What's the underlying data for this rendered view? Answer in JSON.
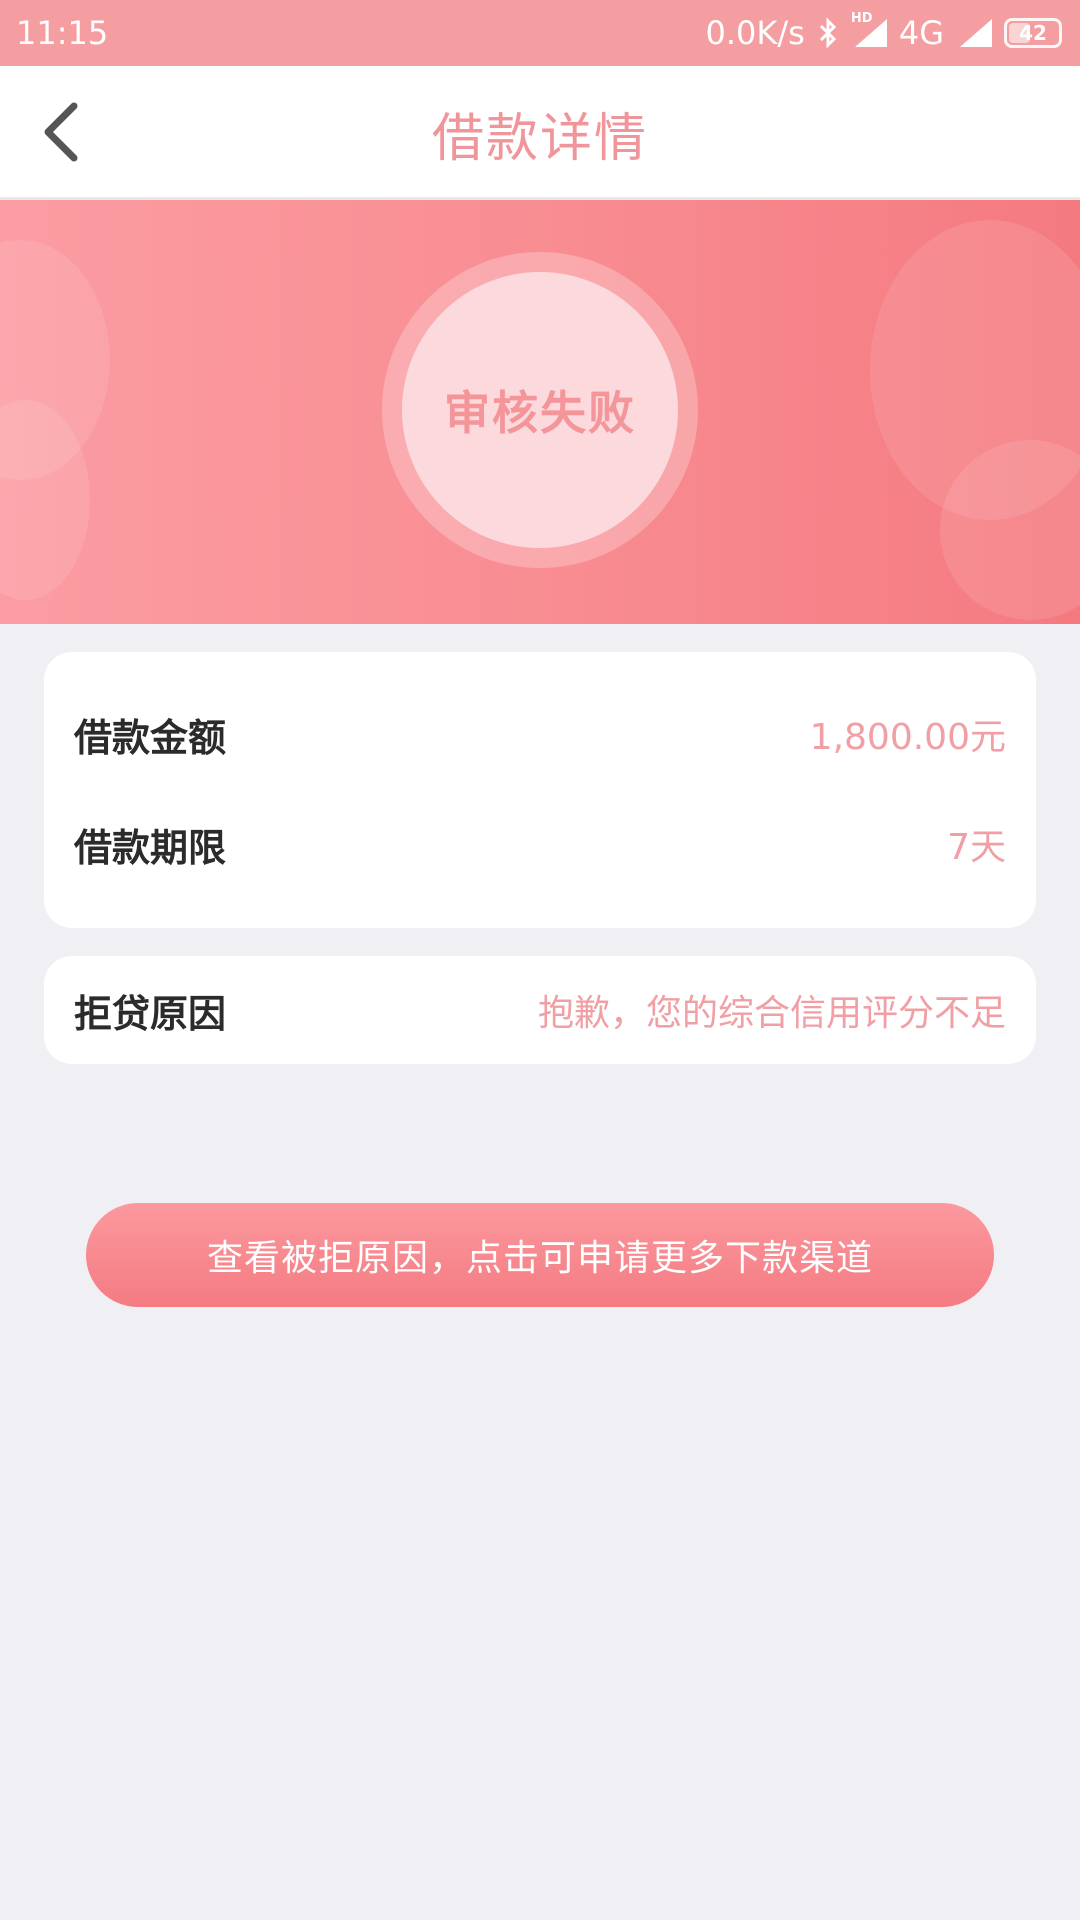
{
  "status_bar": {
    "time": "11:15",
    "network_speed": "0.0K/s",
    "network_type": "4G",
    "hd_label": "HD",
    "battery": "42"
  },
  "header": {
    "title": "借款详情",
    "back_icon": "chevron-left-icon"
  },
  "hero": {
    "status_text": "审核失败"
  },
  "loan_details": {
    "rows": [
      {
        "label": "借款金额",
        "value": "1,800.00元"
      },
      {
        "label": "借款期限",
        "value": "7天"
      }
    ]
  },
  "rejection": {
    "label": "拒贷原因",
    "value": "抱歉，您的综合信用评分不足"
  },
  "action": {
    "label": "查看被拒原因，点击可申请更多下款渠道"
  },
  "colors": {
    "accent": "#f0959a",
    "status_bar": "#f49ea1",
    "background": "#efeff4"
  }
}
